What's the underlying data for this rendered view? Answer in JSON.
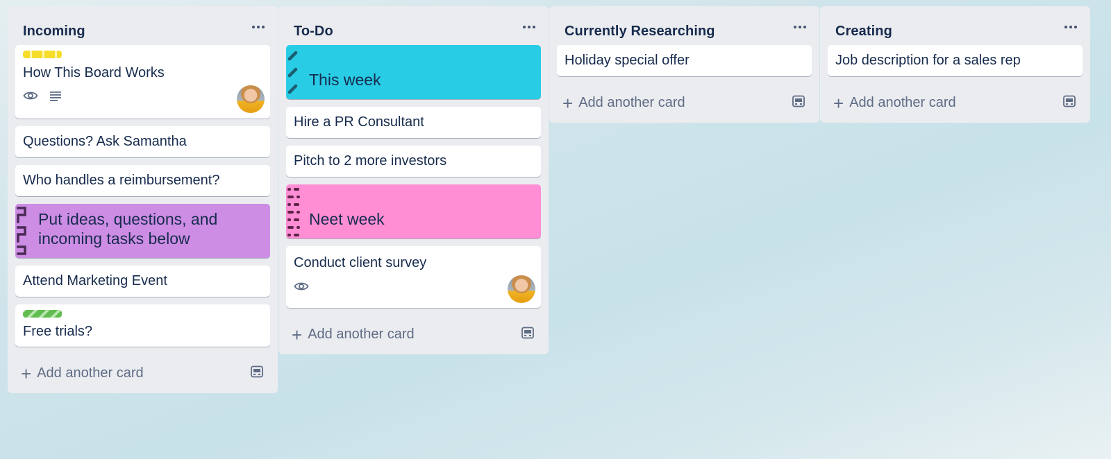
{
  "colors": {
    "list_bg": "#ebecf0",
    "text": "#172b4d",
    "muted": "#5e6c84",
    "cover_cyan": "#29cce5",
    "cover_purple": "#cd8de5",
    "cover_pink": "#ff8ed4",
    "label_yellow": "#f5dd29",
    "label_green": "#61bd4f"
  },
  "lists": [
    {
      "title": "Incoming",
      "menu_icon": "more-horizontal-icon",
      "add_card_label": "Add another card",
      "template_icon": "card-template-icon",
      "cards": [
        {
          "title": "How This Board Works",
          "label_color": "yellow",
          "badges": [
            "eye-icon",
            "description-icon"
          ],
          "has_avatar": true
        },
        {
          "title": "Questions? Ask Samantha"
        },
        {
          "title": "Who handles a reimbursement?"
        },
        {
          "title": "Put ideas, questions, and incoming tasks below",
          "cover": "purple"
        },
        {
          "title": "Attend Marketing Event"
        },
        {
          "title": "Free trials?",
          "label_color": "green"
        }
      ]
    },
    {
      "title": "To-Do",
      "menu_icon": "more-horizontal-icon",
      "add_card_label": "Add another card",
      "template_icon": "card-template-icon",
      "cards": [
        {
          "title": "This week",
          "cover": "cyan"
        },
        {
          "title": "Hire a PR Consultant"
        },
        {
          "title": "Pitch to 2 more investors"
        },
        {
          "title": "Neet week",
          "cover": "pink"
        },
        {
          "title": "Conduct client survey",
          "badges": [
            "eye-icon"
          ],
          "has_avatar": true
        }
      ]
    },
    {
      "title": "Currently Researching",
      "menu_icon": "more-horizontal-icon",
      "add_card_label": "Add another card",
      "template_icon": "card-template-icon",
      "cards": [
        {
          "title": "Holiday special offer"
        }
      ]
    },
    {
      "title": "Creating",
      "menu_icon": "more-horizontal-icon",
      "add_card_label": "Add another card",
      "template_icon": "card-template-icon",
      "cards": [
        {
          "title": "Job description for a sales rep"
        }
      ]
    }
  ]
}
